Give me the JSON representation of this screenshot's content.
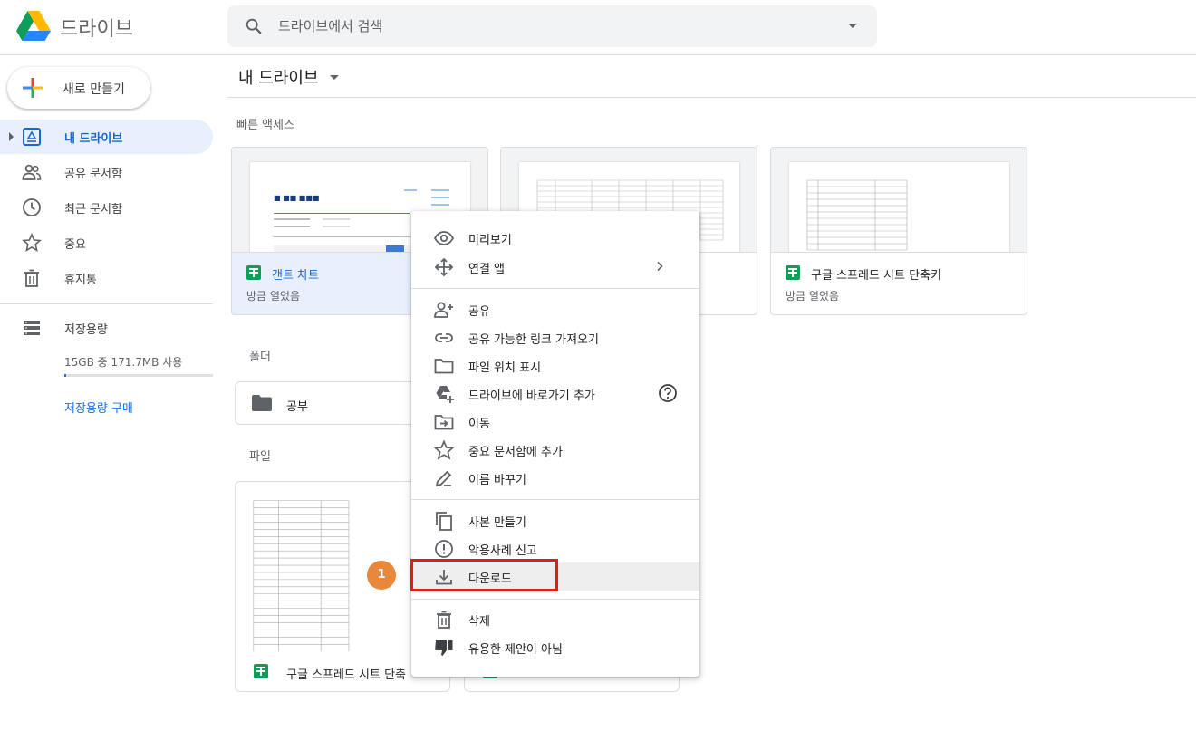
{
  "app": {
    "name": "드라이브"
  },
  "search": {
    "placeholder": "드라이브에서 검색"
  },
  "sidebar": {
    "new_label": "새로 만들기",
    "items": [
      {
        "label": "내 드라이브",
        "icon": "my-drive-icon",
        "active": true
      },
      {
        "label": "공유 문서함",
        "icon": "people-icon"
      },
      {
        "label": "최근 문서함",
        "icon": "clock-icon"
      },
      {
        "label": "중요",
        "icon": "star-icon"
      },
      {
        "label": "휴지통",
        "icon": "trash-icon"
      }
    ],
    "storage": {
      "label": "저장용량",
      "usage": "15GB 중 171.7MB 사용",
      "fraction": 0.011,
      "buy": "저장용량 구매"
    }
  },
  "main": {
    "title": "내 드라이브",
    "quick_access_label": "빠른 액세스",
    "quick_access": [
      {
        "name": "갠트 차트",
        "sub": "방금 열었음"
      },
      {
        "name": "",
        "sub": ""
      },
      {
        "name": "구글 스프레드 시트 단축키",
        "sub": "방금 열었음"
      }
    ],
    "folders_label": "폴더",
    "folders": [
      {
        "name": "공부"
      }
    ],
    "files_label": "파일",
    "files": [
      {
        "name": "구글 스프레드 시트 단축"
      },
      {
        "name": ""
      }
    ]
  },
  "context_menu": {
    "items": [
      {
        "label": "미리보기",
        "icon": "eye-icon"
      },
      {
        "label": "연결 앱",
        "icon": "move-arrows-icon",
        "submenu": true
      },
      {
        "label": "공유",
        "icon": "person-add-icon"
      },
      {
        "label": "공유 가능한 링크 가져오기",
        "icon": "link-icon"
      },
      {
        "label": "파일 위치 표시",
        "icon": "folder-outline-icon"
      },
      {
        "label": "드라이브에 바로가기 추가",
        "icon": "drive-shortcut-icon",
        "help": true
      },
      {
        "label": "이동",
        "icon": "move-to-icon"
      },
      {
        "label": "중요 문서함에 추가",
        "icon": "star-outline-icon"
      },
      {
        "label": "이름 바꾸기",
        "icon": "pencil-icon"
      },
      {
        "label": "사본 만들기",
        "icon": "copy-icon"
      },
      {
        "label": "악용사례 신고",
        "icon": "report-icon"
      },
      {
        "label": "다운로드",
        "icon": "download-icon",
        "hover": true
      },
      {
        "label": "삭제",
        "icon": "trash-icon"
      },
      {
        "label": "유용한 제안이 아님",
        "icon": "thumb-down-icon"
      }
    ]
  },
  "annotation": {
    "step": "1",
    "color": "#e8883a",
    "box_color": "#e31b1b"
  },
  "colors": {
    "accent": "#1a73e8",
    "active_bg": "#e8f0fe",
    "sheets_green": "#0f9d58"
  }
}
